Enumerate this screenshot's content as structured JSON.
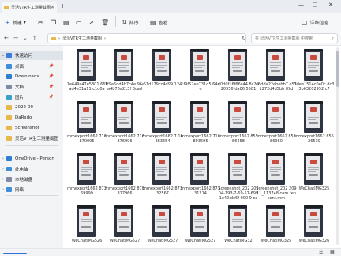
{
  "window": {
    "tab_title": "灵活VTR生工测量截图",
    "new_tab": "+",
    "minimize": "—",
    "maximize": "□",
    "close": "✕"
  },
  "toolbar": {
    "new_label": "新建",
    "new_menu": "▾",
    "sort_label": "排序",
    "view_label": "查看",
    "more_label": "···",
    "details_label": "详细信息"
  },
  "address": {
    "crumbs": [
      "›",
      "灵活VTR生工测量截图",
      "›"
    ],
    "search_placeholder": "在 灵活VTR生工测量截图 中搜索"
  },
  "sidebar": {
    "items": [
      {
        "label": "快速访问",
        "chevron": "⌄",
        "color": "#3b7be0",
        "selected": true
      },
      {
        "label": "桌面",
        "chevron": "",
        "color": "#3f8fd6",
        "pin": "📌"
      },
      {
        "label": "Downloads",
        "chevron": "",
        "color": "#2f7fd0",
        "pin": "📌"
      },
      {
        "label": "文档",
        "chevron": "",
        "color": "#7d8ca3",
        "pin": "📌"
      },
      {
        "label": "图片",
        "chevron": "",
        "color": "#3aa0c8",
        "pin": "📌"
      },
      {
        "label": "2022-09",
        "chevron": "",
        "color": "#e8b84a"
      },
      {
        "label": "DaRedo",
        "chevron": "",
        "color": "#e8b84a"
      },
      {
        "label": "Screenshot",
        "chevron": "",
        "color": "#e8b84a"
      },
      {
        "label": "灵活VTR生工测量截图",
        "chevron": "",
        "color": "#e8b84a"
      },
      {
        "label": "OneDrive - Person",
        "chevron": "›",
        "color": "#2f7fd0"
      },
      {
        "label": "此电脑",
        "chevron": "›",
        "color": "#3f8fd6"
      },
      {
        "label": "本地磁盘",
        "chevron": "›",
        "color": "#7d8ca3"
      },
      {
        "label": "网络",
        "chevron": "›",
        "color": "#3f8fd6"
      }
    ]
  },
  "files": [
    {
      "name": "7e649c47e5301 66fad4e31a11 c1d0a"
    },
    {
      "name": "1f9e5dd4b7c4e 96ea4b76a213f 8cad"
    },
    {
      "name": "61d179cc4d99 124"
    },
    {
      "name": "1f9f52ee731d5 64de"
    },
    {
      "name": "c0d0f16f66c44 8c2020556fda86 5581"
    },
    {
      "name": "e8dda22ebebb7 e511272d4d5bb 89d"
    },
    {
      "name": "3dee1514c0e0c dc33b63202952 c7"
    },
    {
      "name": "mmexport1662 716870095"
    },
    {
      "name": "mmexport1662 716876996"
    },
    {
      "name": "mmexport1662 7 16883654"
    },
    {
      "name": "mmexport1662 716893595"
    },
    {
      "name": "mmexport1662 85586458"
    },
    {
      "name": "mmexport1662 85586950"
    },
    {
      "name": "mmexport1662 85526539"
    },
    {
      "name": "mmexport1662 87369999"
    },
    {
      "name": "mmexport1662 878817966"
    },
    {
      "name": "mmexport1662 87332567"
    },
    {
      "name": "mmexport1662 87331214"
    },
    {
      "name": "Screenshot_202 20904-193-7-69-57-6991e40.de5f-900 9 com"
    },
    {
      "name": "Screenshot_202 20911_113748 com.tencent.mm"
    },
    {
      "name": "WeChatIMG325"
    },
    {
      "name": "WeChatIMG526"
    },
    {
      "name": "WeChatIMG527"
    },
    {
      "name": "WeChatIMG527"
    },
    {
      "name": "WeChatIMG527"
    },
    {
      "name": "WeChatIMG32"
    },
    {
      "name": "WeChatIMG325"
    },
    {
      "name": "WeChatIMG326"
    }
  ]
}
